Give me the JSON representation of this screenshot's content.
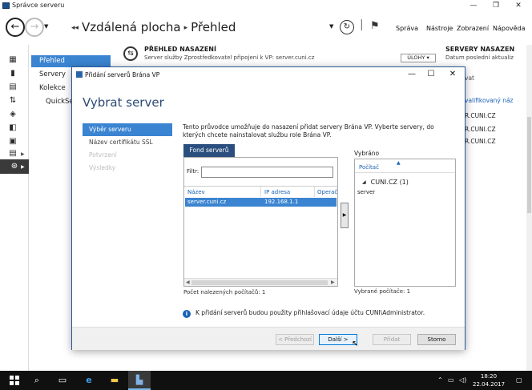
{
  "window": {
    "title": "Správce serveru",
    "minimize": "—",
    "maximize": "❐",
    "close": "✕"
  },
  "header": {
    "breadcrumb_root": "Vzdálená plocha",
    "breadcrumb_page": "Přehled",
    "menu": [
      "Správa",
      "Nástroje",
      "Zobrazení",
      "Nápověda"
    ]
  },
  "nav": {
    "items": [
      "Přehled",
      "Servery",
      "Kolekce",
      "QuickSe"
    ]
  },
  "main": {
    "deployment_title": "PŘEHLED NASAZENÍ",
    "deployment_sub": "Server služby Zprostředkovatel připojení k VP: server.cuni.cz",
    "tasks_label": "ÚLOHY ▾",
    "servers_title": "SERVERY NASAZEN",
    "servers_sub": "Datum poslední aktualiz",
    "servers_search": "vat",
    "servers_col": "valifikovaný náz",
    "fqdns": [
      "R.CUNI.CZ",
      "R.CUNI.CZ",
      "R.CUNI.CZ"
    ]
  },
  "dialog": {
    "title": "Přidání serverů Brána VP",
    "heading": "Vybrat server",
    "steps": [
      {
        "label": "Výběr serveru",
        "state": "current"
      },
      {
        "label": "Název certifikátu SSL",
        "state": "normal"
      },
      {
        "label": "Potvrzení",
        "state": "disabled"
      },
      {
        "label": "Výsledky",
        "state": "disabled"
      }
    ],
    "intro": "Tento průvodce umožňuje do nasazení přidat servery Brána VP. Vyberte servery, do kterých chcete nainstalovat službu role Brána VP.",
    "pool_tab": "Fond serverů",
    "filter_label": "Filtr:",
    "filter_value": "",
    "columns": [
      "Název",
      "IP adresa",
      "Operač"
    ],
    "rows": [
      {
        "name": "server.cuni.cz",
        "ip": "192.168.1.1"
      }
    ],
    "pool_count": "Počet nalezených počítačů: 1",
    "move_label": "▶",
    "selected_label": "Vybráno",
    "selected_col": "Počítač",
    "selected_group": "CUNI.CZ (1)",
    "selected_item": "server",
    "selected_count": "Vybrané počítače: 1",
    "info": "K přidání serverů budou použity přihlašovací údaje účtu CUNI\\Administrator.",
    "buttons": {
      "prev": "< Předchozí",
      "next": "Další >",
      "add": "Přidat",
      "cancel": "Storno"
    },
    "window_controls": {
      "minimize": "—",
      "maximize": "☐",
      "close": "✕"
    }
  },
  "taskbar": {
    "time": "18:20",
    "date": "22.04.2017"
  },
  "colors": {
    "accent": "#3a84d1",
    "heading": "#2b4a76",
    "tab": "#2a4e7e"
  }
}
